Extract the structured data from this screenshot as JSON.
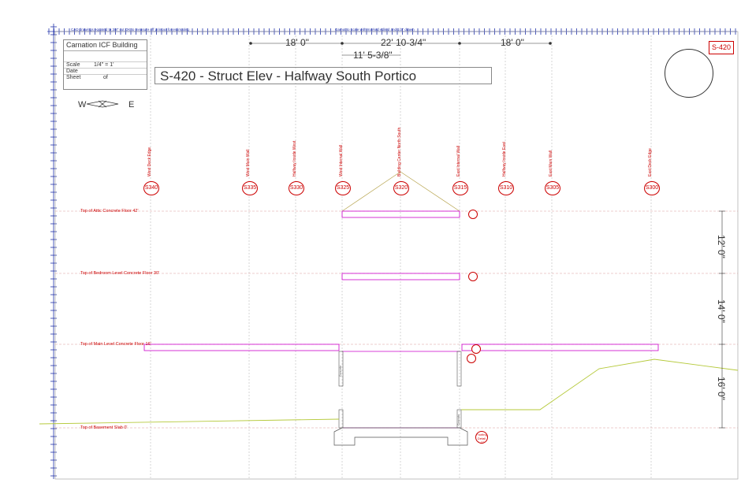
{
  "title_block": {
    "project": "Carnation ICF Building",
    "rows": [
      {
        "label": "Scale",
        "value": "1/4\" = 1'"
      },
      {
        "label": "Date",
        "value": ""
      },
      {
        "label": "Sheet",
        "value": "of"
      }
    ]
  },
  "drawing_title": "S-420 - Struct Elev - Halfway South Portico",
  "sheet_number": "S-420",
  "orientation": {
    "west": "W",
    "east": "E"
  },
  "top_notes": {
    "left": "CAD drawings equated to 3/8\" cut OK to measure off printout for estimating",
    "right": "Gamut to scale with marked edited and 1/2\" drawn"
  },
  "dimensions": {
    "top": [
      "18' 0\"",
      "22' 10-3/4\"",
      "18' 0\""
    ],
    "sub": "11' 5-3/8\"",
    "right": [
      "12' 0\"",
      "14' 0\"",
      "16' 0\""
    ]
  },
  "gridlines": [
    {
      "label": "West Deck Edge",
      "tag": "S340"
    },
    {
      "label": "West Main Wall",
      "tag": "S335"
    },
    {
      "label": "Halfway Inside West",
      "tag": "S330"
    },
    {
      "label": "West Internal Wall",
      "tag": "S325"
    },
    {
      "label": "Building Center North South",
      "tag": "S320"
    },
    {
      "label": "East Internal Wall",
      "tag": "S315"
    },
    {
      "label": "Halfway Inside East",
      "tag": "S310"
    },
    {
      "label": "East Main Wall",
      "tag": "S305"
    },
    {
      "label": "East Deck Edge",
      "tag": "S300"
    }
  ],
  "levels": [
    "Top of Attic Concrete Floor 42'",
    "Top of Bedroom Level Concrete Floor 30'",
    "Top of Main Level Concrete Floor 16'",
    "Top of Basement Slab 0'"
  ],
  "material_notes": [
    "Concrete",
    "Concrete",
    "Concrete",
    "Concrete"
  ],
  "footing_tag": "Footing Detail S-025",
  "colors": {
    "annotation": "#cc0000",
    "grade": "#b5c93a",
    "slab": "#cc00cc",
    "line": "#333333"
  }
}
